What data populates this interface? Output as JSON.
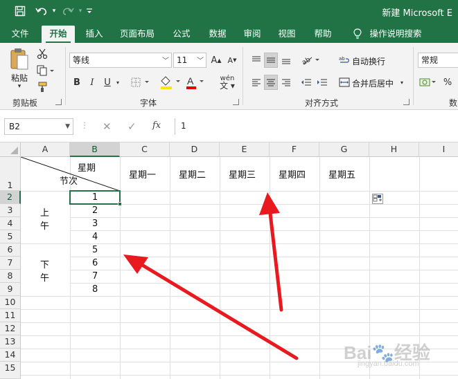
{
  "window": {
    "title": "新建 Microsoft E",
    "accent_color": "#217346"
  },
  "ribbon_tabs": [
    {
      "label": "文件"
    },
    {
      "label": "开始",
      "active": true
    },
    {
      "label": "插入"
    },
    {
      "label": "页面布局"
    },
    {
      "label": "公式"
    },
    {
      "label": "数据"
    },
    {
      "label": "审阅"
    },
    {
      "label": "视图"
    },
    {
      "label": "帮助"
    },
    {
      "label": "操作说明搜索"
    }
  ],
  "ribbon": {
    "clipboard": {
      "paste_label": "粘贴",
      "group_label": "剪贴板"
    },
    "font": {
      "font_name": "等线",
      "font_size": "11",
      "group_label": "字体",
      "bold": "B",
      "italic": "I",
      "underline": "U",
      "font_color_letter": "A",
      "highlight_color": "#ffe600",
      "font_color": "#e00000",
      "wen_label": "wén"
    },
    "alignment": {
      "wrap_label": "自动换行",
      "merge_label": "合并后居中",
      "group_label": "对齐方式"
    },
    "number": {
      "format": "常规",
      "group_label": "数"
    }
  },
  "formula_bar": {
    "name_box": "B2",
    "fx_label": "fx",
    "value": "1"
  },
  "sheet": {
    "columns": [
      "A",
      "B",
      "C",
      "D",
      "E",
      "F",
      "G",
      "H",
      "I"
    ],
    "rows": [
      "1",
      "2",
      "3",
      "4",
      "5",
      "6",
      "7",
      "8",
      "9",
      "10",
      "11",
      "12",
      "13",
      "14",
      "15"
    ],
    "header_row": {
      "diag_top": "星期",
      "diag_bottom": "节次",
      "days": [
        "星期一",
        "星期二",
        "星期三",
        "星期四",
        "星期五"
      ]
    },
    "morning": [
      "上",
      "午"
    ],
    "afternoon": [
      "下",
      "午"
    ],
    "periods": [
      "1",
      "2",
      "3",
      "4",
      "5",
      "6",
      "7",
      "8"
    ],
    "active_cell": "B2"
  },
  "annotations": {
    "arrow_color": "#e8191f"
  },
  "watermark": {
    "brand": "Bai",
    "brand_suffix": "经验",
    "url": "jingyan.baidu.com"
  }
}
